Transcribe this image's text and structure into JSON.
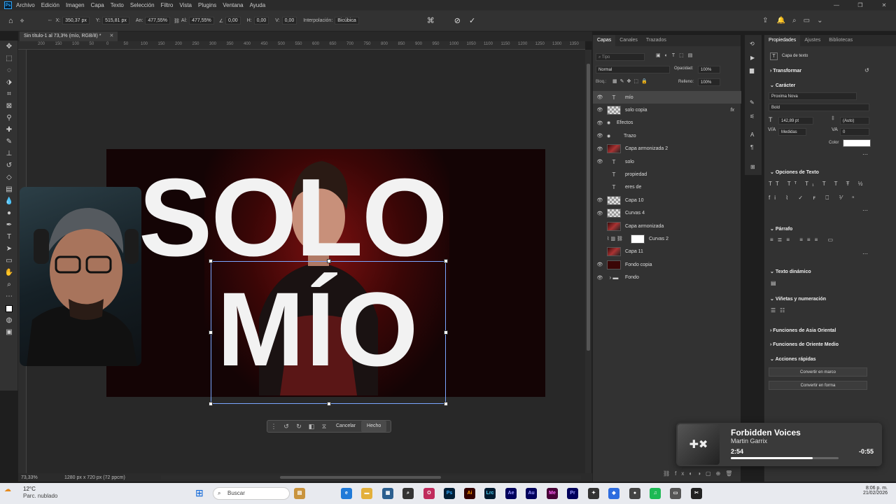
{
  "menubar": {
    "items": [
      "Archivo",
      "Edición",
      "Imagen",
      "Capa",
      "Texto",
      "Selección",
      "Filtro",
      "Vista",
      "Plugins",
      "Ventana",
      "Ayuda"
    ]
  },
  "options": {
    "x_label": "X:",
    "x_value": "350,37 px",
    "y_label": "Y:",
    "y_value": "515,81 px",
    "w_label": "An:",
    "w_value": "477,55%",
    "h_label": "Al:",
    "h_value": "477,55%",
    "angle_value": "0,00",
    "hskew_label": "H:",
    "hskew_value": "0,00",
    "vskew_label": "V:",
    "vskew_value": "0,00",
    "interp_label": "Interpolación:",
    "interp_value": "Bicúbica"
  },
  "document": {
    "tab_title": "Sin título-1 al 73,3% (mío, RGB/8) *",
    "zoom": "73,33%",
    "size_info": "1280 px x 720 px (72 ppcm)",
    "ruler_ticks": [
      "200",
      "150",
      "100",
      "50",
      "0",
      "50",
      "100",
      "150",
      "200",
      "250",
      "300",
      "350",
      "400",
      "450",
      "500",
      "550",
      "600",
      "650",
      "700",
      "750",
      "800",
      "850",
      "900",
      "950",
      "1000",
      "1050",
      "1100",
      "1150",
      "1200",
      "1250",
      "1300",
      "1350"
    ]
  },
  "artwork": {
    "line1": "SOLO",
    "line2": "MÍO"
  },
  "transform_bar": {
    "cancel": "Cancelar",
    "done": "Hecho"
  },
  "layers_panel": {
    "tabs": [
      "Capas",
      "Canales",
      "Trazados"
    ],
    "search_placeholder": "Tipo",
    "blend_mode": "Normal",
    "opacity_label": "Opacidad:",
    "opacity_value": "100%",
    "fill_label": "Relleno:",
    "fill_value": "100%",
    "lock_label": "Bloq.:",
    "layers": [
      {
        "name": "mío",
        "kind": "text",
        "visible": true,
        "selected": true
      },
      {
        "name": "solo  copia",
        "kind": "checker",
        "visible": true,
        "fx": "fx"
      },
      {
        "name": "Efectos",
        "kind": "effects",
        "visible": true
      },
      {
        "name": "Trazo",
        "kind": "effect",
        "visible": true
      },
      {
        "name": "Capa armonizada 2",
        "kind": "photo",
        "visible": true
      },
      {
        "name": "solo",
        "kind": "text",
        "visible": true
      },
      {
        "name": "propiedad",
        "kind": "text",
        "visible": false
      },
      {
        "name": "eres de",
        "kind": "text",
        "visible": false
      },
      {
        "name": "Capa 10",
        "kind": "checker",
        "visible": true
      },
      {
        "name": "Curvas 4",
        "kind": "checker",
        "visible": true
      },
      {
        "name": "Capa armonizada",
        "kind": "photo",
        "visible": false
      },
      {
        "name": "Curvas 2",
        "kind": "curves",
        "visible": false
      },
      {
        "name": "Capa 11",
        "kind": "photo",
        "visible": false
      },
      {
        "name": "Fondo copia",
        "kind": "dark",
        "visible": true
      },
      {
        "name": "Fondo",
        "kind": "folder",
        "visible": true
      }
    ]
  },
  "properties_panel": {
    "tabs": [
      "Propiedades",
      "Ajustes",
      "Bibliotecas"
    ],
    "layer_kind": "Capa de texto",
    "transform": "Transformar",
    "character": "Carácter",
    "font": "Proxima Nova",
    "weight": "Bold",
    "size": "142,89 pt",
    "leading": "(Auto)",
    "kerning": "Medidas",
    "tracking": "0",
    "color_label": "Color",
    "text_options": "Opciones de Texto",
    "paragraph": "Párrafo",
    "dynamic_text": "Texto dinámico",
    "bullets": "Viñetas y numeración",
    "east_asian": "Funciones de Asia Oriental",
    "middle_east": "Funciones de Oriente Medio",
    "quick_actions": "Acciones rápidas",
    "btn_frame": "Convertir en marco",
    "btn_shape": "Convertir en forma",
    "text_color": "#ffffff"
  },
  "media": {
    "title": "Forbidden Voices",
    "artist": "Martin Garrix",
    "elapsed": "2:54",
    "remaining": "-0:55",
    "progress": 0.76
  },
  "taskbar": {
    "temp": "12°C",
    "weather": "Parc. nublado",
    "search": "Buscar",
    "time": "8:06 p. m.",
    "date": "21/02/2026"
  },
  "colors": {
    "accent": "#31a8ff",
    "selection": "#7aa6ff",
    "bg": "#1e1e1e"
  }
}
